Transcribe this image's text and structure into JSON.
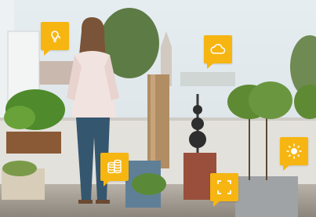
{
  "scene": {
    "subject": "woman-standing-on-balcony",
    "colors": {
      "callout": "#f6b511",
      "icon": "#ffffff"
    }
  },
  "callouts": [
    {
      "icon": "light-bulb-icon"
    },
    {
      "icon": "cloud-icon"
    },
    {
      "icon": "coins-icon"
    },
    {
      "icon": "frame-corners-icon"
    },
    {
      "icon": "sun-icon"
    }
  ]
}
